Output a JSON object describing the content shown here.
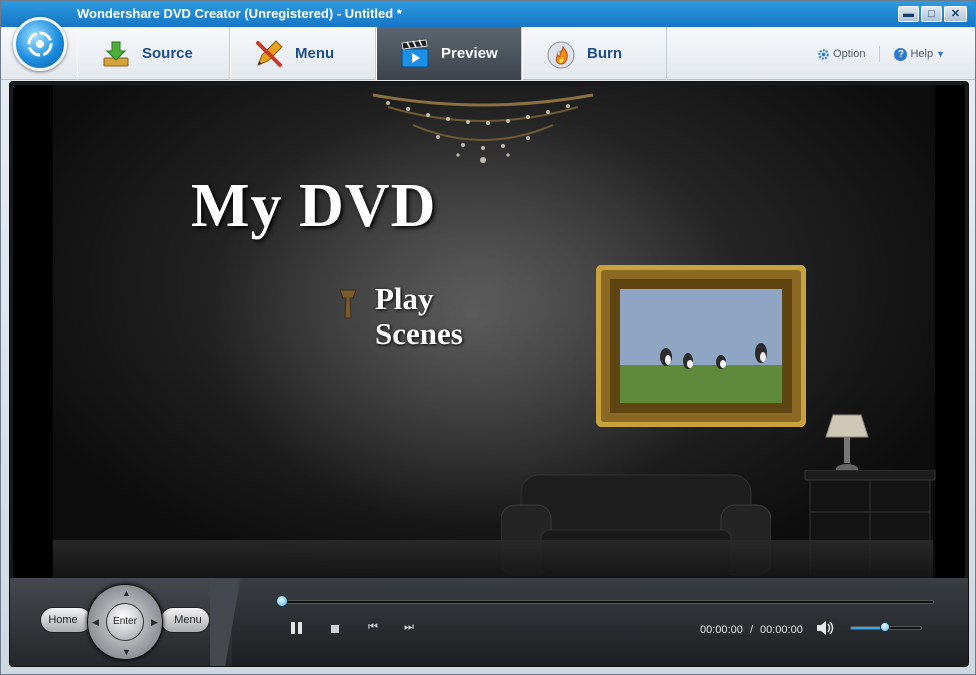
{
  "window": {
    "title": "Wondershare DVD Creator (Unregistered) - Untitled *",
    "controls": {
      "minimize": "▬",
      "maximize": "□",
      "close": "✕"
    }
  },
  "toolbar": {
    "tabs": [
      {
        "label": "Source",
        "icon": "download-icon",
        "active": false
      },
      {
        "label": "Menu",
        "icon": "edit-tools-icon",
        "active": false
      },
      {
        "label": "Preview",
        "icon": "clapperboard-icon",
        "active": true
      },
      {
        "label": "Burn",
        "icon": "disc-flame-icon",
        "active": false
      }
    ],
    "option_label": "Option",
    "help_label": "Help"
  },
  "preview": {
    "dvd_title": "My DVD",
    "menu_items": [
      "Play",
      "Scenes"
    ]
  },
  "player": {
    "home_label": "Home",
    "enter_label": "Enter",
    "menu_label": "Menu",
    "current_time": "00:00:00",
    "time_separator": "/",
    "total_time": "00:00:00",
    "seek_progress": 0,
    "volume_level": 0.5
  },
  "colors": {
    "accent": "#1b8ee0",
    "active_tab": "#4a5159",
    "tab_text": "#1d4f8c"
  }
}
